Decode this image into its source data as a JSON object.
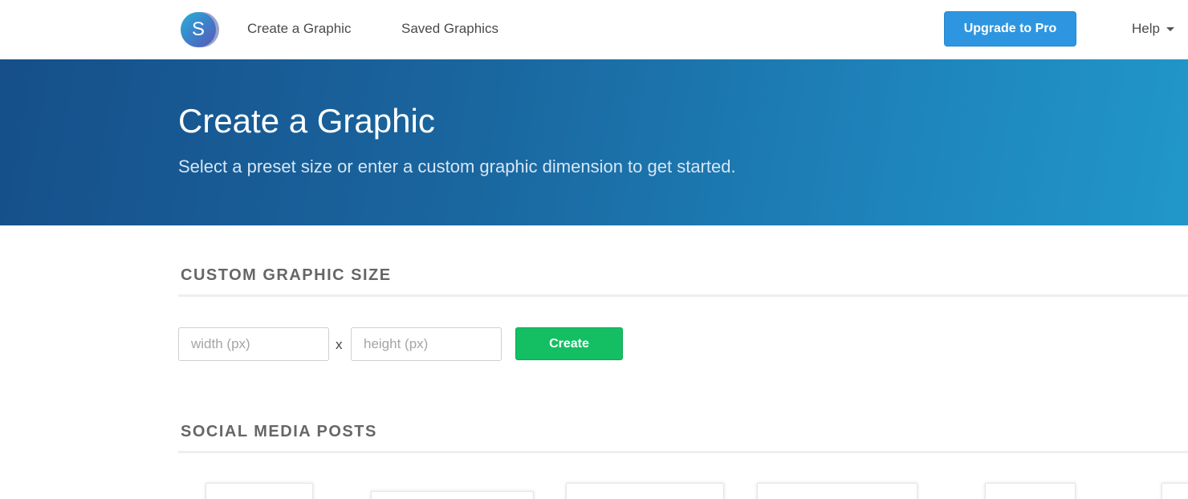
{
  "nav": {
    "logo_letter": "S",
    "create_link": "Create a Graphic",
    "saved_link": "Saved Graphics",
    "upgrade_button": "Upgrade to Pro",
    "help_menu": "Help"
  },
  "hero": {
    "title": "Create a Graphic",
    "subtitle": "Select a preset size or enter a custom graphic dimension to get started."
  },
  "custom_size": {
    "heading": "CUSTOM GRAPHIC SIZE",
    "width_placeholder": "width (px)",
    "separator": "x",
    "height_placeholder": "height (px)",
    "create_button": "Create"
  },
  "social_media": {
    "heading": "SOCIAL MEDIA POSTS"
  },
  "colors": {
    "hero_gradient_start": "#164f8a",
    "hero_gradient_end": "#2197c9",
    "upgrade_button": "#2e96e0",
    "create_button": "#14bf64"
  }
}
